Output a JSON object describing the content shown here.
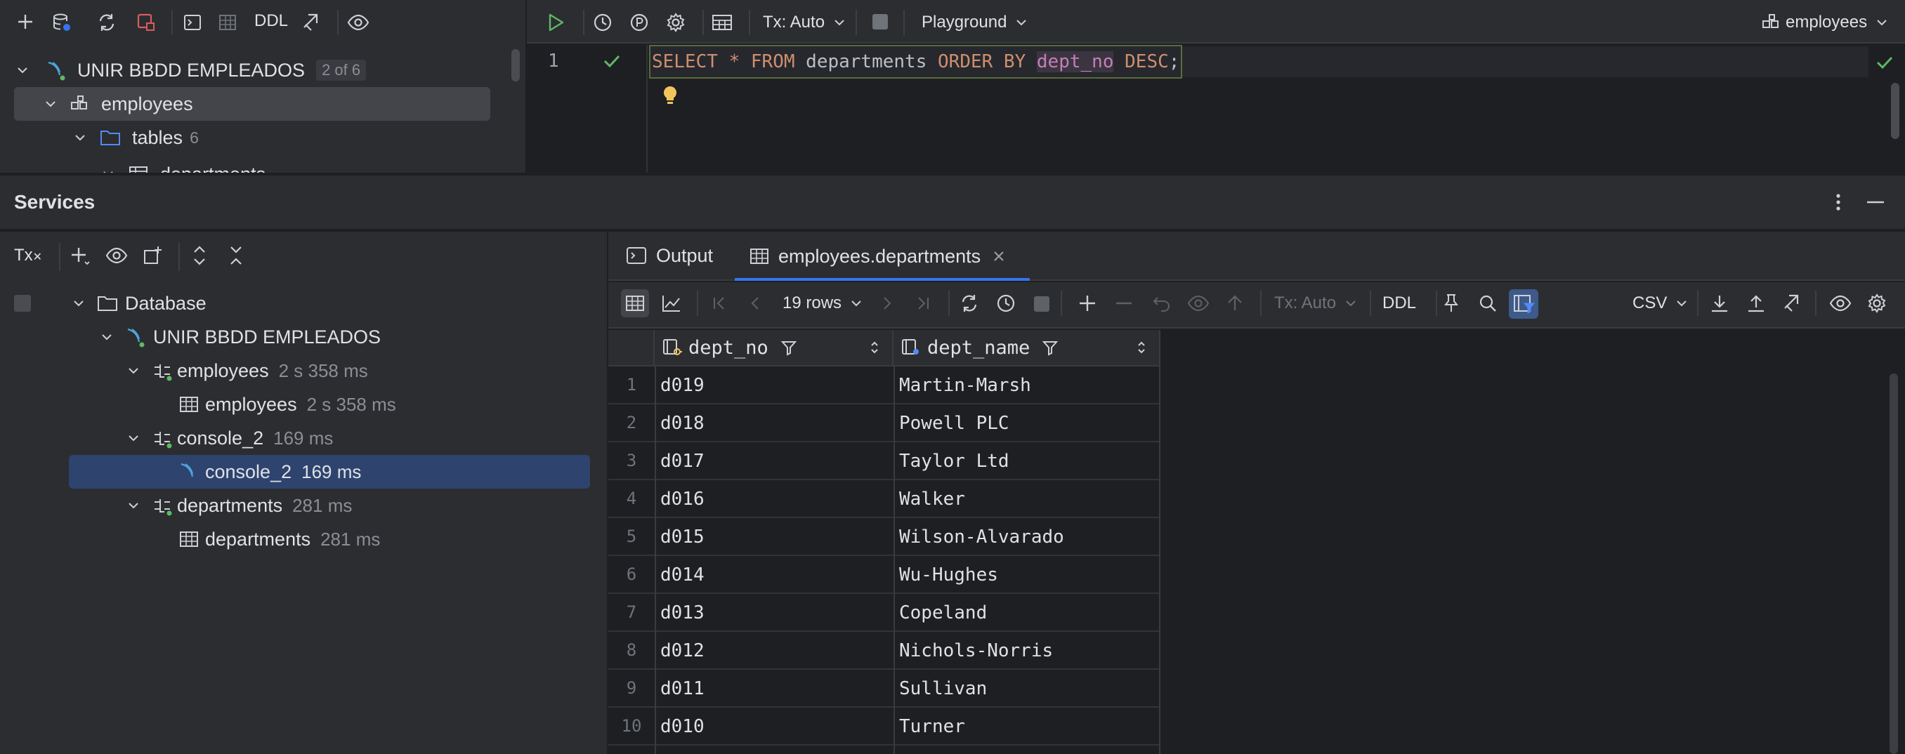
{
  "top_toolbar": {
    "ddl_label": "DDL"
  },
  "db_tree": {
    "connection": "UNIR BBDD EMPLEADOS",
    "connection_badge": "2 of 6",
    "schema": "employees",
    "tables_label": "tables",
    "tables_count": "6",
    "partial_table": "departments"
  },
  "editor_toolbar": {
    "tx_label": "Tx: Auto",
    "playground_label": "Playground",
    "schema_selector": "employees"
  },
  "editor": {
    "line_number": "1",
    "sql_tokens": [
      {
        "text": "SELECT",
        "color": "#cf8e6d"
      },
      {
        "text": " ",
        "color": "#bcbec4"
      },
      {
        "text": "*",
        "color": "#cf8e6d"
      },
      {
        "text": " ",
        "color": "#bcbec4"
      },
      {
        "text": "FROM",
        "color": "#cf8e6d"
      },
      {
        "text": " departments ",
        "color": "#bcbec4"
      },
      {
        "text": "ORDER BY",
        "color": "#cf8e6d"
      },
      {
        "text": " ",
        "color": "#bcbec4"
      },
      {
        "text": "dept_no",
        "color": "#c77dbb"
      },
      {
        "text": " ",
        "color": "#bcbec4"
      },
      {
        "text": "DESC",
        "color": "#cf8e6d"
      },
      {
        "text": ";",
        "color": "#bcbec4"
      }
    ]
  },
  "services": {
    "title": "Services",
    "tx_icon_label": "Tx",
    "tree": {
      "database": "Database",
      "connection": "UNIR BBDD EMPLEADOS",
      "sessions": [
        {
          "name": "employees",
          "time": "2 s 358 ms",
          "child": "employees",
          "child_time": "2 s 358 ms"
        },
        {
          "name": "console_2",
          "time": "169 ms",
          "child": "console_2",
          "child_time": "169 ms"
        },
        {
          "name": "departments",
          "time": "281 ms",
          "child": "departments",
          "child_time": "281 ms"
        }
      ]
    }
  },
  "result_tabs": {
    "output_label": "Output",
    "table_tab_label": "employees.departments"
  },
  "grid_toolbar": {
    "rows_label": "19 rows",
    "tx_label": "Tx: Auto",
    "ddl_label": "DDL",
    "export_format": "CSV"
  },
  "grid": {
    "columns": [
      "dept_no",
      "dept_name"
    ],
    "rows": [
      {
        "n": "1",
        "dept_no": "d019",
        "dept_name": "Martin-Marsh"
      },
      {
        "n": "2",
        "dept_no": "d018",
        "dept_name": "Powell PLC"
      },
      {
        "n": "3",
        "dept_no": "d017",
        "dept_name": "Taylor Ltd"
      },
      {
        "n": "4",
        "dept_no": "d016",
        "dept_name": "Walker"
      },
      {
        "n": "5",
        "dept_no": "d015",
        "dept_name": "Wilson-Alvarado"
      },
      {
        "n": "6",
        "dept_no": "d014",
        "dept_name": "Wu-Hughes"
      },
      {
        "n": "7",
        "dept_no": "d013",
        "dept_name": "Copeland"
      },
      {
        "n": "8",
        "dept_no": "d012",
        "dept_name": "Nichols-Norris"
      },
      {
        "n": "9",
        "dept_no": "d011",
        "dept_name": "Sullivan"
      },
      {
        "n": "10",
        "dept_no": "d010",
        "dept_name": "Turner"
      }
    ]
  }
}
